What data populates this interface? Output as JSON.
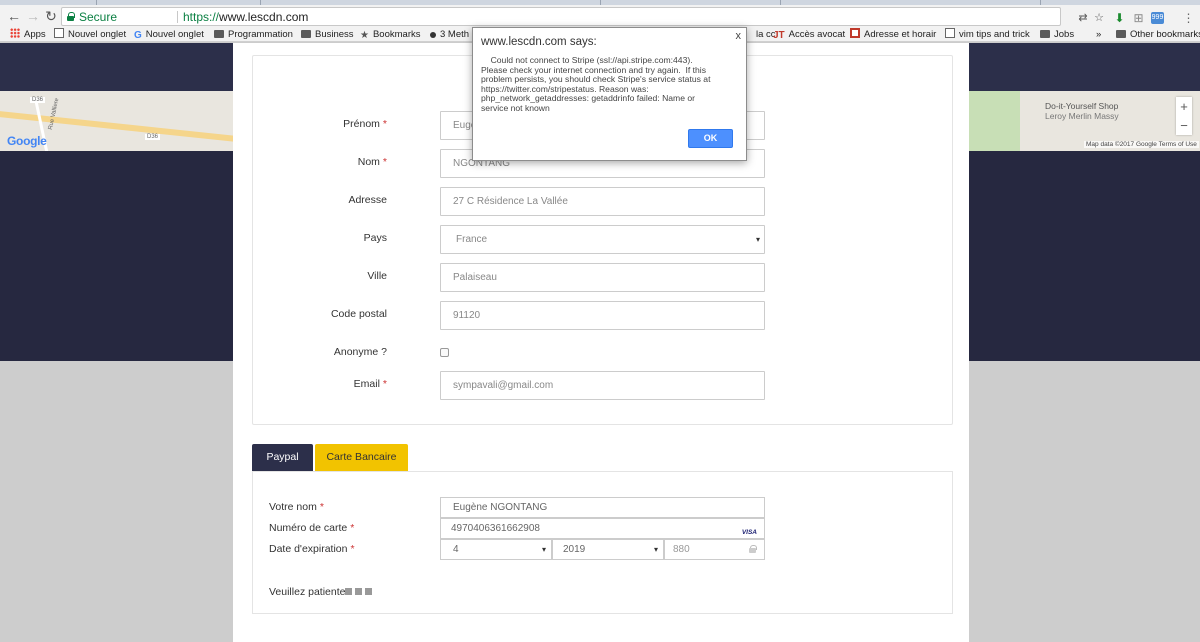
{
  "browser": {
    "secure_label": "Secure",
    "url_scheme": "https://",
    "url_host": "www.lescdn.com",
    "ext_badge": "999"
  },
  "bookmarks": {
    "items": [
      {
        "label": "Apps",
        "icon": "apps-grid-icon"
      },
      {
        "label": "Nouvel onglet",
        "icon": "page-icon"
      },
      {
        "label": "Nouvel onglet",
        "icon": "google-icon"
      },
      {
        "label": "Programmation",
        "icon": "folder-icon"
      },
      {
        "label": "Business",
        "icon": "folder-icon"
      },
      {
        "label": "Bookmarks",
        "icon": "star-icon"
      },
      {
        "label": "3 Meth",
        "icon": "dot-icon"
      },
      {
        "label": "la cc",
        "icon": "page-icon"
      },
      {
        "label": "Accès avocat",
        "icon": "jt-icon"
      },
      {
        "label": "Adresse et horair",
        "icon": "bookmark-icon"
      },
      {
        "label": "vim tips and trick",
        "icon": "page-icon"
      },
      {
        "label": "Jobs",
        "icon": "folder-icon"
      },
      {
        "label": "»",
        "icon": ""
      },
      {
        "label": "Other bookmarks",
        "icon": "folder-icon"
      }
    ]
  },
  "map": {
    "google": "Google",
    "road_label1": "D36",
    "road_label2": "D36",
    "street": "Rue Valliere",
    "shop_name": "Do-it-Yourself Shop",
    "shop_sub": "Leroy Merlin Massy",
    "credit": "Map data ©2017 Google   Terms of Use",
    "zoom_in": "+",
    "zoom_out": "−"
  },
  "form": {
    "prenom_label": "Prénom",
    "prenom_value": "Eugè",
    "nom_label": "Nom",
    "nom_value": "NGONTANG",
    "adresse_label": "Adresse",
    "adresse_value": "27 C Résidence La Vallée",
    "pays_label": "Pays",
    "pays_value": "France",
    "ville_label": "Ville",
    "ville_value": "Palaiseau",
    "cp_label": "Code postal",
    "cp_value": "91120",
    "anonyme_label": "Anonyme ?",
    "email_label": "Email",
    "email_value": "sympavali@gmail.com",
    "required_mark": "*"
  },
  "payment": {
    "tab_paypal": "Paypal",
    "tab_carte": "Carte Bancaire",
    "nom_label": "Votre nom",
    "nom_value": "Eugène NGONTANG",
    "carte_label": "Numéro de carte",
    "carte_value": "4970406361662908",
    "card_brand": "VISA",
    "exp_label": "Date d'expiration",
    "exp_month": "4",
    "exp_year": "2019",
    "cvc_value": "880",
    "wait_text": "Veuillez patienter"
  },
  "dialog": {
    "title": "www.lescdn.com says:",
    "close": "x",
    "message": "    Could not connect to Stripe (ssl://api.stripe.com:443).\nPlease check your internet connection and try again.  If this\nproblem persists, you should check Stripe's service status at\nhttps://twitter.com/stripestatus. Reason was:\nphp_network_getaddresses: getaddrinfo failed: Name or\nservice not known",
    "ok": "OK"
  }
}
